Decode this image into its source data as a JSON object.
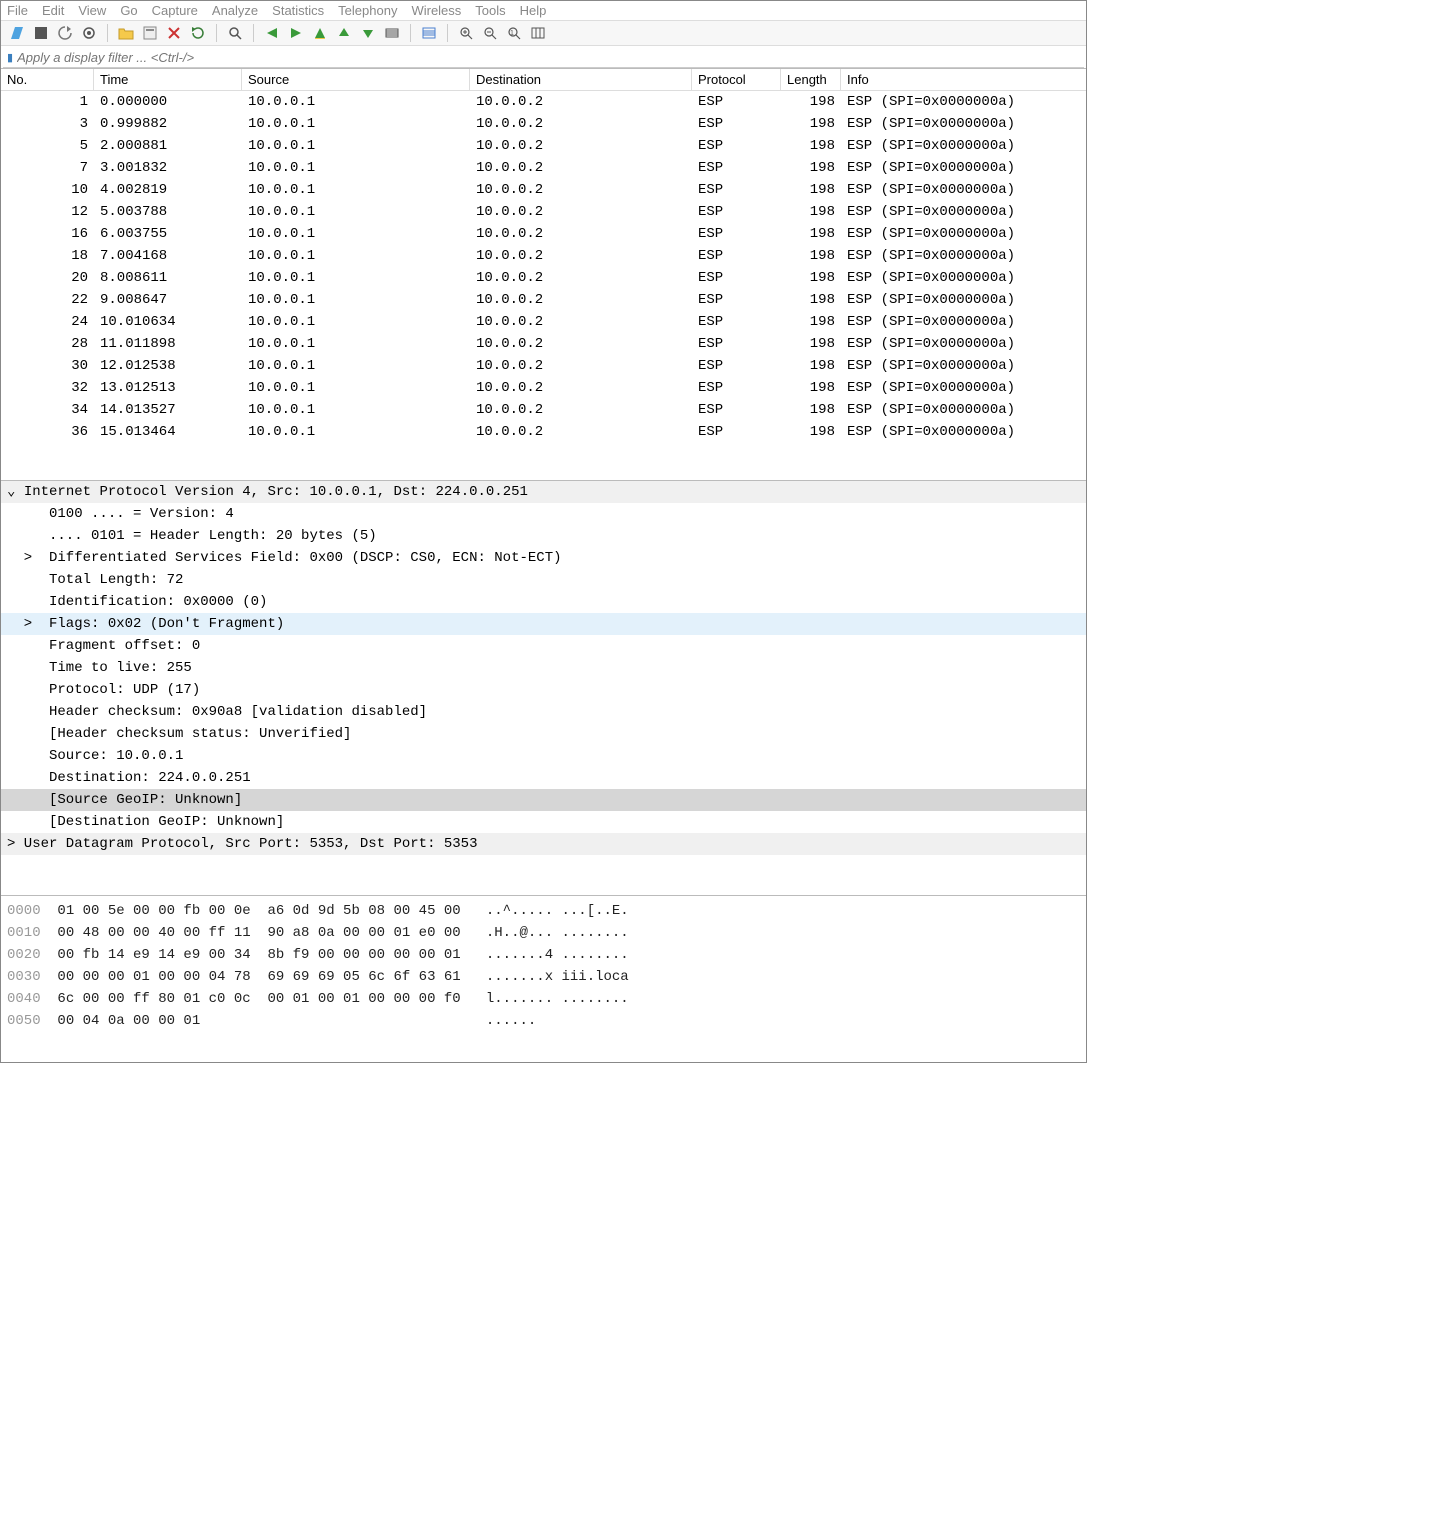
{
  "menubar": [
    "File",
    "Edit",
    "View",
    "Go",
    "Capture",
    "Analyze",
    "Statistics",
    "Telephony",
    "Wireless",
    "Tools",
    "Help"
  ],
  "toolbar_icons": [
    "fin-icon",
    "stop-icon",
    "restart-icon",
    "options-icon",
    "sep",
    "open-icon",
    "save-icon",
    "close-icon",
    "reload-icon",
    "sep",
    "find-icon",
    "sep",
    "back-icon",
    "forward-icon",
    "jump-icon",
    "up-icon",
    "down-icon",
    "goto-icon",
    "sep",
    "auto-scroll-icon",
    "sep",
    "zoom-in-icon",
    "zoom-out-icon",
    "zoom-reset-icon",
    "columns-icon"
  ],
  "filter": {
    "placeholder": "Apply a display filter ... <Ctrl-/>"
  },
  "columns": {
    "no": "No.",
    "time": "Time",
    "source": "Source",
    "dest": "Destination",
    "proto": "Protocol",
    "len": "Length",
    "info": "Info"
  },
  "packets": [
    {
      "no": "1",
      "time": "0.000000",
      "src": "10.0.0.1",
      "dst": "10.0.0.2",
      "proto": "ESP",
      "len": "198",
      "info": "ESP (SPI=0x0000000a)"
    },
    {
      "no": "3",
      "time": "0.999882",
      "src": "10.0.0.1",
      "dst": "10.0.0.2",
      "proto": "ESP",
      "len": "198",
      "info": "ESP (SPI=0x0000000a)"
    },
    {
      "no": "5",
      "time": "2.000881",
      "src": "10.0.0.1",
      "dst": "10.0.0.2",
      "proto": "ESP",
      "len": "198",
      "info": "ESP (SPI=0x0000000a)"
    },
    {
      "no": "7",
      "time": "3.001832",
      "src": "10.0.0.1",
      "dst": "10.0.0.2",
      "proto": "ESP",
      "len": "198",
      "info": "ESP (SPI=0x0000000a)"
    },
    {
      "no": "10",
      "time": "4.002819",
      "src": "10.0.0.1",
      "dst": "10.0.0.2",
      "proto": "ESP",
      "len": "198",
      "info": "ESP (SPI=0x0000000a)"
    },
    {
      "no": "12",
      "time": "5.003788",
      "src": "10.0.0.1",
      "dst": "10.0.0.2",
      "proto": "ESP",
      "len": "198",
      "info": "ESP (SPI=0x0000000a)"
    },
    {
      "no": "16",
      "time": "6.003755",
      "src": "10.0.0.1",
      "dst": "10.0.0.2",
      "proto": "ESP",
      "len": "198",
      "info": "ESP (SPI=0x0000000a)"
    },
    {
      "no": "18",
      "time": "7.004168",
      "src": "10.0.0.1",
      "dst": "10.0.0.2",
      "proto": "ESP",
      "len": "198",
      "info": "ESP (SPI=0x0000000a)"
    },
    {
      "no": "20",
      "time": "8.008611",
      "src": "10.0.0.1",
      "dst": "10.0.0.2",
      "proto": "ESP",
      "len": "198",
      "info": "ESP (SPI=0x0000000a)"
    },
    {
      "no": "22",
      "time": "9.008647",
      "src": "10.0.0.1",
      "dst": "10.0.0.2",
      "proto": "ESP",
      "len": "198",
      "info": "ESP (SPI=0x0000000a)"
    },
    {
      "no": "24",
      "time": "10.010634",
      "src": "10.0.0.1",
      "dst": "10.0.0.2",
      "proto": "ESP",
      "len": "198",
      "info": "ESP (SPI=0x0000000a)"
    },
    {
      "no": "28",
      "time": "11.011898",
      "src": "10.0.0.1",
      "dst": "10.0.0.2",
      "proto": "ESP",
      "len": "198",
      "info": "ESP (SPI=0x0000000a)"
    },
    {
      "no": "30",
      "time": "12.012538",
      "src": "10.0.0.1",
      "dst": "10.0.0.2",
      "proto": "ESP",
      "len": "198",
      "info": "ESP (SPI=0x0000000a)"
    },
    {
      "no": "32",
      "time": "13.012513",
      "src": "10.0.0.1",
      "dst": "10.0.0.2",
      "proto": "ESP",
      "len": "198",
      "info": "ESP (SPI=0x0000000a)"
    },
    {
      "no": "34",
      "time": "14.013527",
      "src": "10.0.0.1",
      "dst": "10.0.0.2",
      "proto": "ESP",
      "len": "198",
      "info": "ESP (SPI=0x0000000a)"
    },
    {
      "no": "36",
      "time": "15.013464",
      "src": "10.0.0.1",
      "dst": "10.0.0.2",
      "proto": "ESP",
      "len": "198",
      "info": "ESP (SPI=0x0000000a)"
    }
  ],
  "details": [
    {
      "cls": "top",
      "pre": "⌄ ",
      "text": "Internet Protocol Version 4, Src: 10.0.0.1, Dst: 224.0.0.251"
    },
    {
      "cls": "",
      "pre": "     ",
      "text": "0100 .... = Version: 4"
    },
    {
      "cls": "",
      "pre": "     ",
      "text": ".... 0101 = Header Length: 20 bytes (5)"
    },
    {
      "cls": "",
      "pre": "  >  ",
      "text": "Differentiated Services Field: 0x00 (DSCP: CS0, ECN: Not-ECT)"
    },
    {
      "cls": "",
      "pre": "     ",
      "text": "Total Length: 72"
    },
    {
      "cls": "",
      "pre": "     ",
      "text": "Identification: 0x0000 (0)"
    },
    {
      "cls": "hl",
      "pre": "  >  ",
      "text": "Flags: 0x02 (Don't Fragment)"
    },
    {
      "cls": "",
      "pre": "     ",
      "text": "Fragment offset: 0"
    },
    {
      "cls": "",
      "pre": "     ",
      "text": "Time to live: 255"
    },
    {
      "cls": "",
      "pre": "     ",
      "text": "Protocol: UDP (17)"
    },
    {
      "cls": "",
      "pre": "     ",
      "text": "Header checksum: 0x90a8 [validation disabled]"
    },
    {
      "cls": "",
      "pre": "     ",
      "text": "[Header checksum status: Unverified]"
    },
    {
      "cls": "",
      "pre": "     ",
      "text": "Source: 10.0.0.1"
    },
    {
      "cls": "",
      "pre": "     ",
      "text": "Destination: 224.0.0.251"
    },
    {
      "cls": "sel",
      "pre": "     ",
      "text": "[Source GeoIP: Unknown]"
    },
    {
      "cls": "",
      "pre": "     ",
      "text": "[Destination GeoIP: Unknown]"
    },
    {
      "cls": "top",
      "pre": "> ",
      "text": "User Datagram Protocol, Src Port: 5353, Dst Port: 5353"
    }
  ],
  "hex": [
    {
      "off": "0000",
      "b": "01 00 5e 00 00 fb 00 0e  a6 0d 9d 5b 08 00 45 00",
      "a": "..^..... ...[..E."
    },
    {
      "off": "0010",
      "b": "00 48 00 00 40 00 ff 11  90 a8 0a 00 00 01 e0 00",
      "a": ".H..@... ........"
    },
    {
      "off": "0020",
      "b": "00 fb 14 e9 14 e9 00 34  8b f9 00 00 00 00 00 01",
      "a": ".......4 ........"
    },
    {
      "off": "0030",
      "b": "00 00 00 01 00 00 04 78  69 69 69 05 6c 6f 63 61",
      "a": ".......x iii.loca"
    },
    {
      "off": "0040",
      "b": "6c 00 00 ff 80 01 c0 0c  00 01 00 01 00 00 00 f0",
      "a": "l....... ........"
    },
    {
      "off": "0050",
      "b": "00 04 0a 00 00 01",
      "a": "......"
    }
  ]
}
